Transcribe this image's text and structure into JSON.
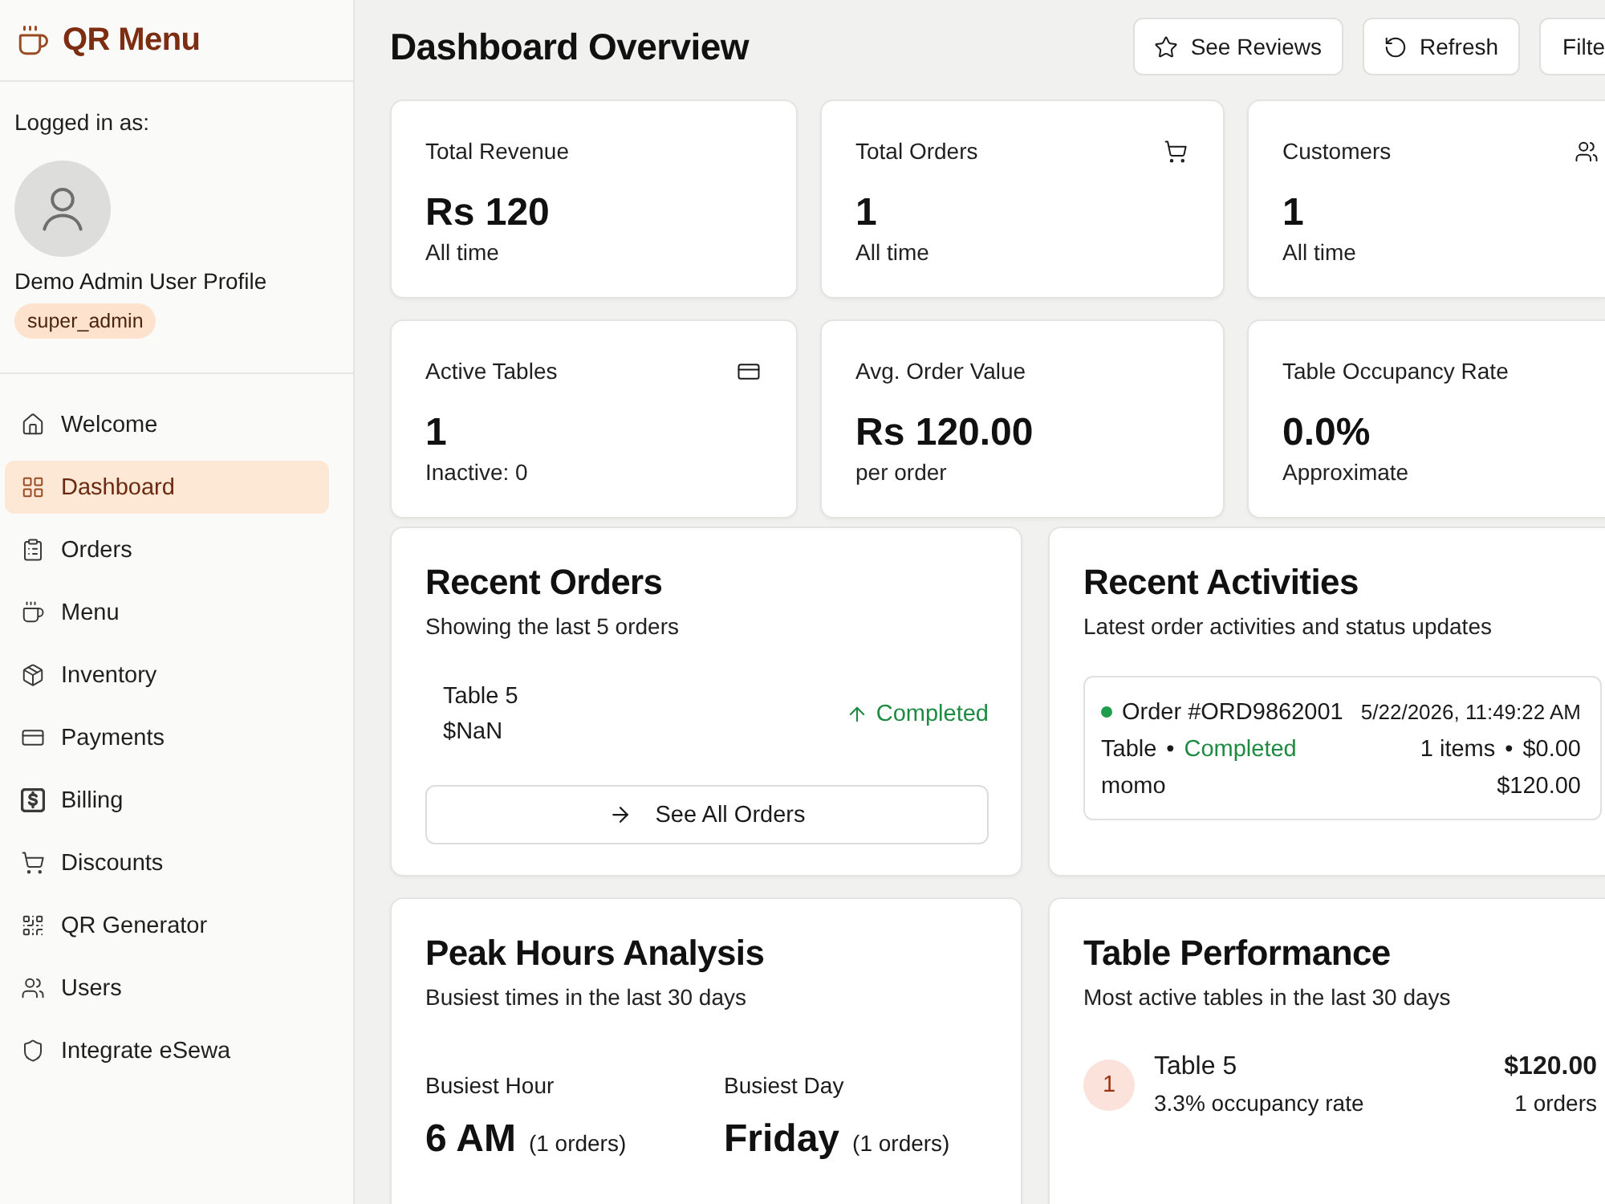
{
  "sidebar": {
    "brand": "QR Menu",
    "logged_in_label": "Logged in as:",
    "user": {
      "name": "Demo Admin User Profile",
      "role": "super_admin"
    },
    "nav": [
      {
        "label": "Welcome",
        "selected": false
      },
      {
        "label": "Dashboard",
        "selected": true
      },
      {
        "label": "Orders",
        "selected": false
      },
      {
        "label": "Menu",
        "selected": false
      },
      {
        "label": "Inventory",
        "selected": false
      },
      {
        "label": "Payments",
        "selected": false
      },
      {
        "label": "Billing",
        "selected": false
      },
      {
        "label": "Discounts",
        "selected": false
      },
      {
        "label": "QR Generator",
        "selected": false
      },
      {
        "label": "Users",
        "selected": false
      },
      {
        "label": "Integrate eSewa",
        "selected": false
      }
    ]
  },
  "header": {
    "title": "Dashboard Overview",
    "buttons": [
      {
        "label": "See Reviews"
      },
      {
        "label": "Refresh"
      },
      {
        "label": "Filte"
      }
    ]
  },
  "stats": [
    {
      "label": "Total Revenue",
      "value": "Rs 120",
      "note": "All time"
    },
    {
      "label": "Total Orders",
      "value": "1",
      "note": "All time"
    },
    {
      "label": "Customers",
      "value": "1",
      "note": "All time"
    },
    {
      "label": "Active Tables",
      "value": "1",
      "note": "Inactive: 0"
    },
    {
      "label": "Avg. Order Value",
      "value": "Rs 120.00",
      "note": "per order"
    },
    {
      "label": "Table Occupancy Rate",
      "value": "0.0%",
      "note": "Approximate"
    }
  ],
  "recent_orders": {
    "title": "Recent Orders",
    "subtitle": "Showing the last 5 orders",
    "orders": [
      {
        "table": "Table 5",
        "amount": "$NaN",
        "status": "Completed",
        "kind": "completed"
      }
    ],
    "button": "See All Orders"
  },
  "recent_activities": {
    "title": "Recent Activities",
    "subtitle": "Latest order activities and status updates",
    "items": [
      {
        "order": "Order #ORD9862001",
        "color": "#1f9d4c",
        "time": "5/22/2026, 11:49:22 AM",
        "table": "Table",
        "separator_1": "•",
        "status": "Completed",
        "kind": "completed",
        "count": "1 items",
        "separator_2": "•",
        "amount": "$0.00",
        "product": "momo",
        "total": "$120.00"
      }
    ]
  },
  "peak_hours": {
    "title": "Peak Hours Analysis",
    "subtitle": "Busiest times in the last 30 days",
    "stats": [
      {
        "label": "Busiest Hour",
        "value": "6 AM",
        "count": "(1 orders)"
      },
      {
        "label": "Busiest Day",
        "value": "Friday",
        "count": "(1 orders)"
      }
    ]
  },
  "table_performance": {
    "title": "Table Performance",
    "subtitle": "Most active tables in the last 30 days",
    "tables": [
      {
        "rank": "1",
        "name": "Table 5",
        "occupancy": "3.3% occupancy rate",
        "revenue": "$120.00",
        "orders": "1 orders"
      }
    ]
  }
}
